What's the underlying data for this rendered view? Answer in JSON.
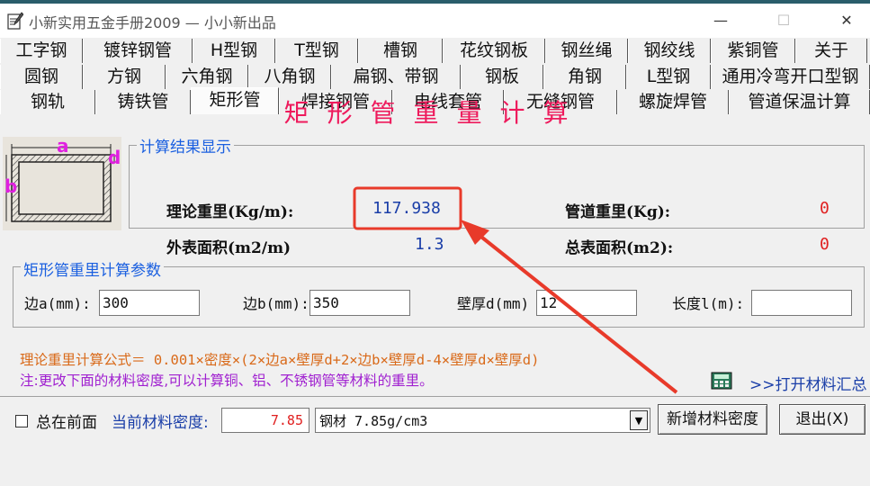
{
  "window": {
    "title": "小新实用五金手册2009 — 小小新出品",
    "min_glyph": "—",
    "max_glyph": "☐",
    "close_glyph": "✕"
  },
  "tabs": {
    "row1": [
      "工字钢",
      "镀锌钢管",
      "H型钢",
      "T型钢",
      "槽钢",
      "花纹钢板",
      "钢丝绳",
      "钢绞线",
      "紫铜管",
      "关于"
    ],
    "row2": [
      "圆钢",
      "方钢",
      "六角钢",
      "八角钢",
      "扁钢、带钢",
      "钢板",
      "角钢",
      "L型钢",
      "通用冷弯开口型钢"
    ],
    "row3": [
      "钢轨",
      "铸铁管",
      "矩形管",
      "焊接钢管",
      "电线套管",
      "无缝钢管",
      "螺旋焊管",
      "管道保温计算"
    ],
    "active": "矩形管"
  },
  "heading": "矩形管重量计算",
  "diagram": {
    "label_a": "a",
    "label_b": "b",
    "label_d": "d"
  },
  "results": {
    "group_label": "计算结果显示",
    "theory_weight_label": "理论重里(Kg/m):",
    "theory_weight_value": "117.938",
    "surface_area_label": "外表面积(m2/m)",
    "surface_area_value": "1.3",
    "pipe_weight_label": "管道重里(Kg):",
    "pipe_weight_value": "0",
    "total_area_label": "总表面积(m2):",
    "total_area_value": "0"
  },
  "params": {
    "group_label": "矩形管重里计算参数",
    "side_a_label": "边a(mm):",
    "side_a_value": "300",
    "side_b_label": "边b(mm):",
    "side_b_value": "350",
    "thickness_label": "壁厚d(mm)",
    "thickness_value": "12",
    "length_label": "长度l(m):",
    "length_value": ""
  },
  "formula": "理论重里计算公式＝ 0.001×密度×(2×边a×壁厚d+2×边b×壁厚d-4×壁厚d×壁厚d)",
  "note": "注:更改下面的材料密度,可以计算铜、铝、不锈钢管等材料的重里。",
  "open_summary": ">>打开材料汇总",
  "bottom": {
    "always_on_top_label": "总在前面",
    "density_label": "当前材料密度:",
    "density_value": "7.85",
    "material_selected": "钢材 7.85g/cm3",
    "add_density_button": "新增材料密度",
    "exit_button": "退出(X)"
  },
  "colors": {
    "heading": "#ee1a5c",
    "group_label": "#1a5fe0",
    "value_blue": "#1a3ea8",
    "value_red": "#e02020",
    "formula": "#d96a1a",
    "note": "#a020d0",
    "annotation": "#e83a2a"
  },
  "icons": [
    "pencil-notepad-icon",
    "rectangular-tube-diagram",
    "calculator-icon",
    "dropdown-arrow-icon"
  ]
}
